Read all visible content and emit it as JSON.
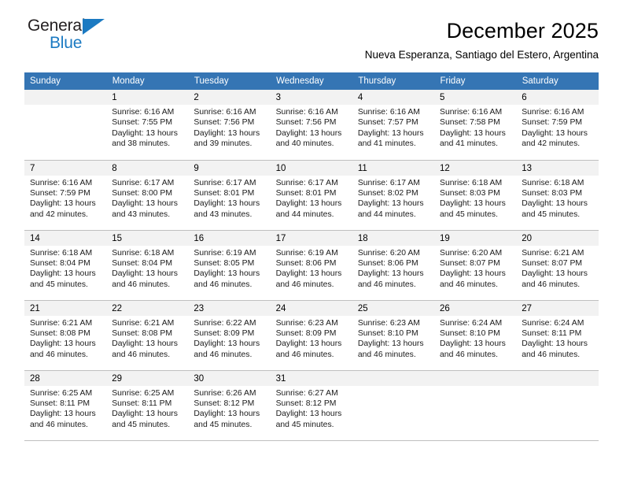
{
  "brand": {
    "name_top": "General",
    "name_bottom": "Blue",
    "accent_color": "#1b7ac2",
    "triangle_icon": "brand-triangle-icon"
  },
  "header": {
    "title": "December 2025",
    "subtitle": "Nueva Esperanza, Santiago del Estero, Argentina"
  },
  "table": {
    "header_background": "#3575b4",
    "daynum_background": "#f2f2f2",
    "columns": [
      "Sunday",
      "Monday",
      "Tuesday",
      "Wednesday",
      "Thursday",
      "Friday",
      "Saturday"
    ]
  },
  "weeks": [
    [
      {
        "day": "",
        "sunrise": "",
        "sunset": "",
        "daylight_1": "",
        "daylight_2": ""
      },
      {
        "day": "1",
        "sunrise": "Sunrise: 6:16 AM",
        "sunset": "Sunset: 7:55 PM",
        "daylight_1": "Daylight: 13 hours",
        "daylight_2": "and 38 minutes."
      },
      {
        "day": "2",
        "sunrise": "Sunrise: 6:16 AM",
        "sunset": "Sunset: 7:56 PM",
        "daylight_1": "Daylight: 13 hours",
        "daylight_2": "and 39 minutes."
      },
      {
        "day": "3",
        "sunrise": "Sunrise: 6:16 AM",
        "sunset": "Sunset: 7:56 PM",
        "daylight_1": "Daylight: 13 hours",
        "daylight_2": "and 40 minutes."
      },
      {
        "day": "4",
        "sunrise": "Sunrise: 6:16 AM",
        "sunset": "Sunset: 7:57 PM",
        "daylight_1": "Daylight: 13 hours",
        "daylight_2": "and 41 minutes."
      },
      {
        "day": "5",
        "sunrise": "Sunrise: 6:16 AM",
        "sunset": "Sunset: 7:58 PM",
        "daylight_1": "Daylight: 13 hours",
        "daylight_2": "and 41 minutes."
      },
      {
        "day": "6",
        "sunrise": "Sunrise: 6:16 AM",
        "sunset": "Sunset: 7:59 PM",
        "daylight_1": "Daylight: 13 hours",
        "daylight_2": "and 42 minutes."
      }
    ],
    [
      {
        "day": "7",
        "sunrise": "Sunrise: 6:16 AM",
        "sunset": "Sunset: 7:59 PM",
        "daylight_1": "Daylight: 13 hours",
        "daylight_2": "and 42 minutes."
      },
      {
        "day": "8",
        "sunrise": "Sunrise: 6:17 AM",
        "sunset": "Sunset: 8:00 PM",
        "daylight_1": "Daylight: 13 hours",
        "daylight_2": "and 43 minutes."
      },
      {
        "day": "9",
        "sunrise": "Sunrise: 6:17 AM",
        "sunset": "Sunset: 8:01 PM",
        "daylight_1": "Daylight: 13 hours",
        "daylight_2": "and 43 minutes."
      },
      {
        "day": "10",
        "sunrise": "Sunrise: 6:17 AM",
        "sunset": "Sunset: 8:01 PM",
        "daylight_1": "Daylight: 13 hours",
        "daylight_2": "and 44 minutes."
      },
      {
        "day": "11",
        "sunrise": "Sunrise: 6:17 AM",
        "sunset": "Sunset: 8:02 PM",
        "daylight_1": "Daylight: 13 hours",
        "daylight_2": "and 44 minutes."
      },
      {
        "day": "12",
        "sunrise": "Sunrise: 6:18 AM",
        "sunset": "Sunset: 8:03 PM",
        "daylight_1": "Daylight: 13 hours",
        "daylight_2": "and 45 minutes."
      },
      {
        "day": "13",
        "sunrise": "Sunrise: 6:18 AM",
        "sunset": "Sunset: 8:03 PM",
        "daylight_1": "Daylight: 13 hours",
        "daylight_2": "and 45 minutes."
      }
    ],
    [
      {
        "day": "14",
        "sunrise": "Sunrise: 6:18 AM",
        "sunset": "Sunset: 8:04 PM",
        "daylight_1": "Daylight: 13 hours",
        "daylight_2": "and 45 minutes."
      },
      {
        "day": "15",
        "sunrise": "Sunrise: 6:18 AM",
        "sunset": "Sunset: 8:04 PM",
        "daylight_1": "Daylight: 13 hours",
        "daylight_2": "and 46 minutes."
      },
      {
        "day": "16",
        "sunrise": "Sunrise: 6:19 AM",
        "sunset": "Sunset: 8:05 PM",
        "daylight_1": "Daylight: 13 hours",
        "daylight_2": "and 46 minutes."
      },
      {
        "day": "17",
        "sunrise": "Sunrise: 6:19 AM",
        "sunset": "Sunset: 8:06 PM",
        "daylight_1": "Daylight: 13 hours",
        "daylight_2": "and 46 minutes."
      },
      {
        "day": "18",
        "sunrise": "Sunrise: 6:20 AM",
        "sunset": "Sunset: 8:06 PM",
        "daylight_1": "Daylight: 13 hours",
        "daylight_2": "and 46 minutes."
      },
      {
        "day": "19",
        "sunrise": "Sunrise: 6:20 AM",
        "sunset": "Sunset: 8:07 PM",
        "daylight_1": "Daylight: 13 hours",
        "daylight_2": "and 46 minutes."
      },
      {
        "day": "20",
        "sunrise": "Sunrise: 6:21 AM",
        "sunset": "Sunset: 8:07 PM",
        "daylight_1": "Daylight: 13 hours",
        "daylight_2": "and 46 minutes."
      }
    ],
    [
      {
        "day": "21",
        "sunrise": "Sunrise: 6:21 AM",
        "sunset": "Sunset: 8:08 PM",
        "daylight_1": "Daylight: 13 hours",
        "daylight_2": "and 46 minutes."
      },
      {
        "day": "22",
        "sunrise": "Sunrise: 6:21 AM",
        "sunset": "Sunset: 8:08 PM",
        "daylight_1": "Daylight: 13 hours",
        "daylight_2": "and 46 minutes."
      },
      {
        "day": "23",
        "sunrise": "Sunrise: 6:22 AM",
        "sunset": "Sunset: 8:09 PM",
        "daylight_1": "Daylight: 13 hours",
        "daylight_2": "and 46 minutes."
      },
      {
        "day": "24",
        "sunrise": "Sunrise: 6:23 AM",
        "sunset": "Sunset: 8:09 PM",
        "daylight_1": "Daylight: 13 hours",
        "daylight_2": "and 46 minutes."
      },
      {
        "day": "25",
        "sunrise": "Sunrise: 6:23 AM",
        "sunset": "Sunset: 8:10 PM",
        "daylight_1": "Daylight: 13 hours",
        "daylight_2": "and 46 minutes."
      },
      {
        "day": "26",
        "sunrise": "Sunrise: 6:24 AM",
        "sunset": "Sunset: 8:10 PM",
        "daylight_1": "Daylight: 13 hours",
        "daylight_2": "and 46 minutes."
      },
      {
        "day": "27",
        "sunrise": "Sunrise: 6:24 AM",
        "sunset": "Sunset: 8:11 PM",
        "daylight_1": "Daylight: 13 hours",
        "daylight_2": "and 46 minutes."
      }
    ],
    [
      {
        "day": "28",
        "sunrise": "Sunrise: 6:25 AM",
        "sunset": "Sunset: 8:11 PM",
        "daylight_1": "Daylight: 13 hours",
        "daylight_2": "and 46 minutes."
      },
      {
        "day": "29",
        "sunrise": "Sunrise: 6:25 AM",
        "sunset": "Sunset: 8:11 PM",
        "daylight_1": "Daylight: 13 hours",
        "daylight_2": "and 45 minutes."
      },
      {
        "day": "30",
        "sunrise": "Sunrise: 6:26 AM",
        "sunset": "Sunset: 8:12 PM",
        "daylight_1": "Daylight: 13 hours",
        "daylight_2": "and 45 minutes."
      },
      {
        "day": "31",
        "sunrise": "Sunrise: 6:27 AM",
        "sunset": "Sunset: 8:12 PM",
        "daylight_1": "Daylight: 13 hours",
        "daylight_2": "and 45 minutes."
      },
      {
        "day": "",
        "sunrise": "",
        "sunset": "",
        "daylight_1": "",
        "daylight_2": ""
      },
      {
        "day": "",
        "sunrise": "",
        "sunset": "",
        "daylight_1": "",
        "daylight_2": ""
      },
      {
        "day": "",
        "sunrise": "",
        "sunset": "",
        "daylight_1": "",
        "daylight_2": ""
      }
    ]
  ]
}
